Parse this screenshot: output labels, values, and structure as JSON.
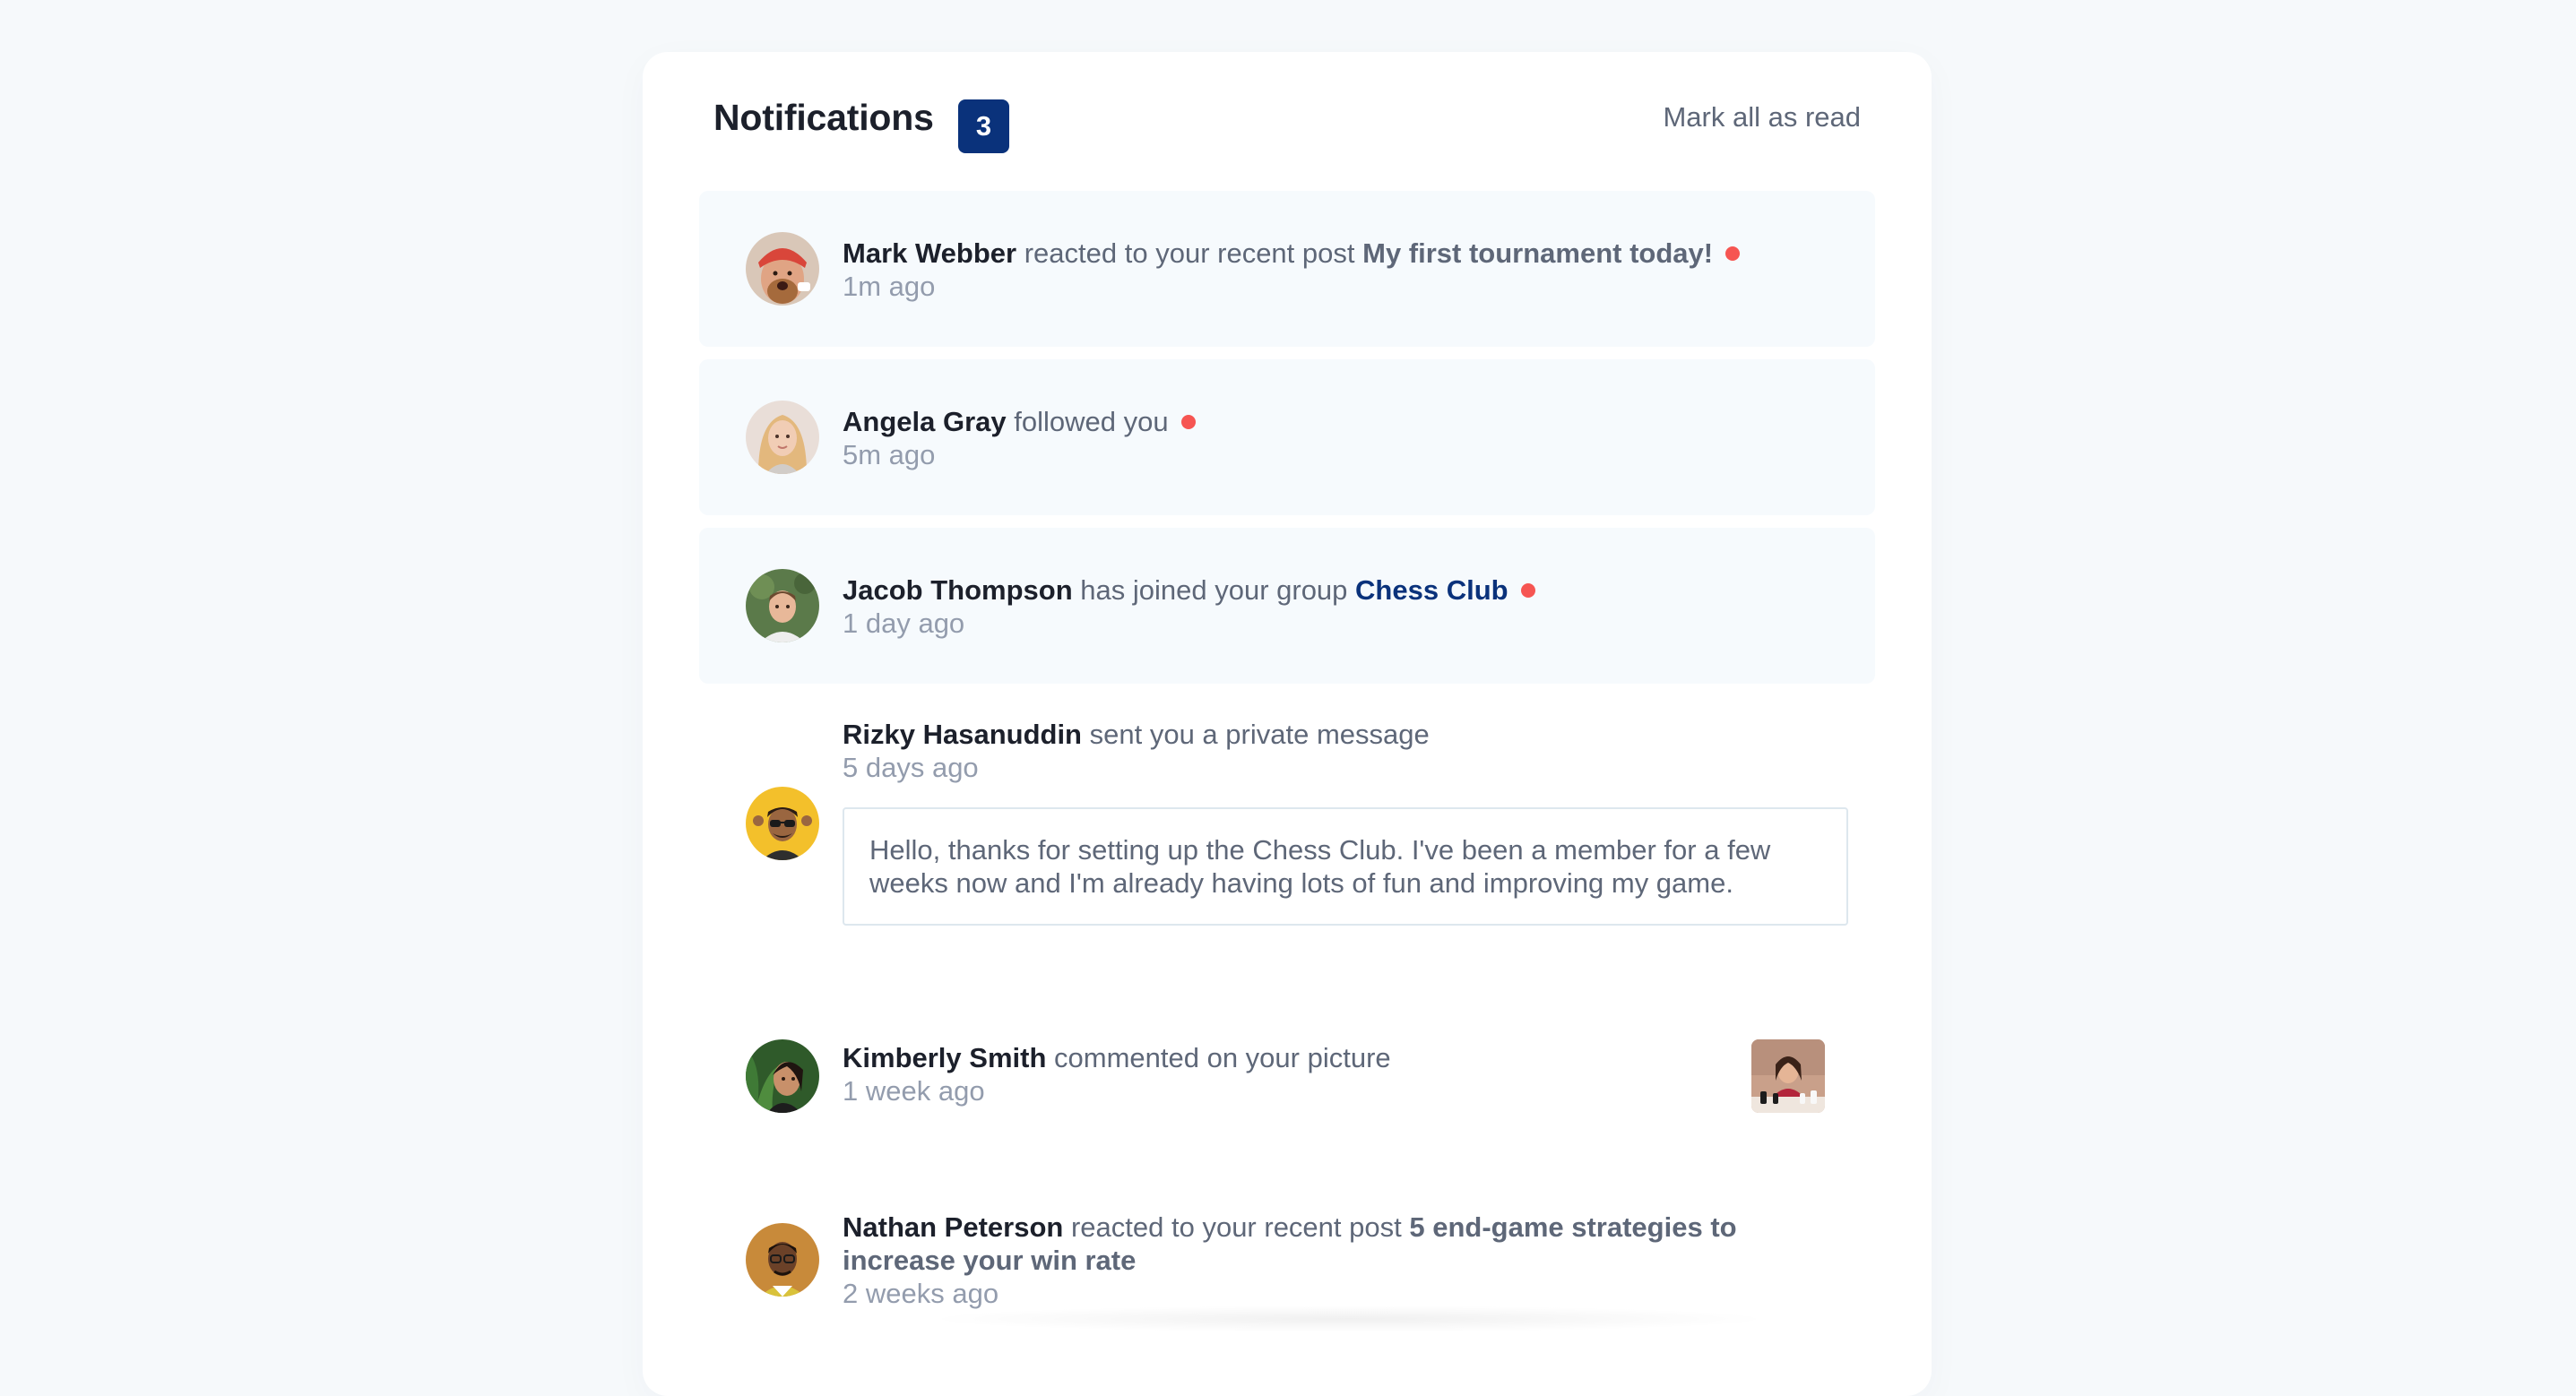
{
  "header": {
    "title": "Notifications",
    "unread_count": "3",
    "mark_all_label": "Mark all as read"
  },
  "notifications": [
    {
      "name": "Mark Webber",
      "action": "reacted to your recent post",
      "target": "My first tournament today!",
      "time": "1m ago",
      "unread": true,
      "avatar_icon": "avatar-mark-webber"
    },
    {
      "name": "Angela Gray",
      "action": "followed you",
      "time": "5m ago",
      "unread": true,
      "avatar_icon": "avatar-angela-gray"
    },
    {
      "name": "Jacob Thompson",
      "action": "has joined your group",
      "target": "Chess Club",
      "time": "1 day ago",
      "unread": true,
      "avatar_icon": "avatar-jacob-thompson"
    },
    {
      "name": "Rizky Hasanuddin",
      "action": "sent you a private message",
      "time": "5 days ago",
      "message": "Hello, thanks for setting up the Chess Club. I've been a member for a few weeks now and I'm already having lots of fun and improving my game.",
      "unread": false,
      "avatar_icon": "avatar-rizky-hasanuddin"
    },
    {
      "name": "Kimberly Smith",
      "action": "commented on your picture",
      "time": "1 week ago",
      "unread": false,
      "avatar_icon": "avatar-kimberly-smith",
      "picture_icon": "chess-picture-thumbnail"
    },
    {
      "name": "Nathan Peterson",
      "action": "reacted to your recent post",
      "target": "5 end-game strategies to increase your win rate",
      "time": "2 weeks ago",
      "unread": false,
      "avatar_icon": "avatar-nathan-peterson"
    }
  ],
  "colors": {
    "page_background": "#f6f9fb",
    "card_background": "#ffffff",
    "unread_background": "#f6fafd",
    "badge_blue": "#0a327b",
    "group_link_blue": "#0a327b",
    "unread_dot_red": "#f65552",
    "text_dark": "#1c202b",
    "text_gray": "#5e6778",
    "text_light": "#939cad"
  }
}
